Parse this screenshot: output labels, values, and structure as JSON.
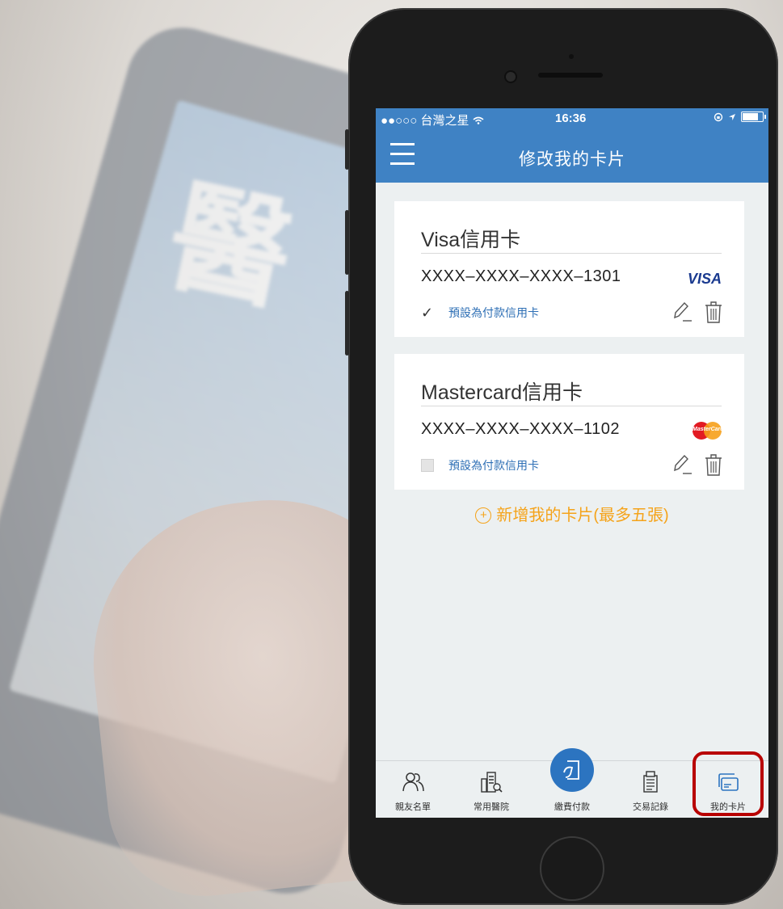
{
  "status_bar": {
    "carrier": "●●○○○ 台灣之星 ",
    "time": "16:36"
  },
  "nav": {
    "title": "修改我的卡片"
  },
  "cards": [
    {
      "title": "Visa信用卡",
      "number": "XXXX–XXXX–XXXX–1301",
      "brand": "VISA",
      "default_label": "預設為付款信用卡",
      "default_checked": true
    },
    {
      "title": "Mastercard信用卡",
      "number": "XXXX–XXXX–XXXX–1102",
      "brand": "MasterCard",
      "default_label": "預設為付款信用卡",
      "default_checked": false
    }
  ],
  "add_card_label": "新增我的卡片(最多五張)",
  "tabs": [
    {
      "label": "親友名單",
      "icon": "people-icon"
    },
    {
      "label": "常用醫院",
      "icon": "hospital-icon"
    },
    {
      "label": "繳費付款",
      "icon": "payment-icon"
    },
    {
      "label": "交易記錄",
      "icon": "receipt-icon"
    },
    {
      "label": "我的卡片",
      "icon": "cards-icon"
    }
  ],
  "colors": {
    "primary": "#3f82c4",
    "accent": "#f5a31a",
    "highlight": "#b80000"
  }
}
